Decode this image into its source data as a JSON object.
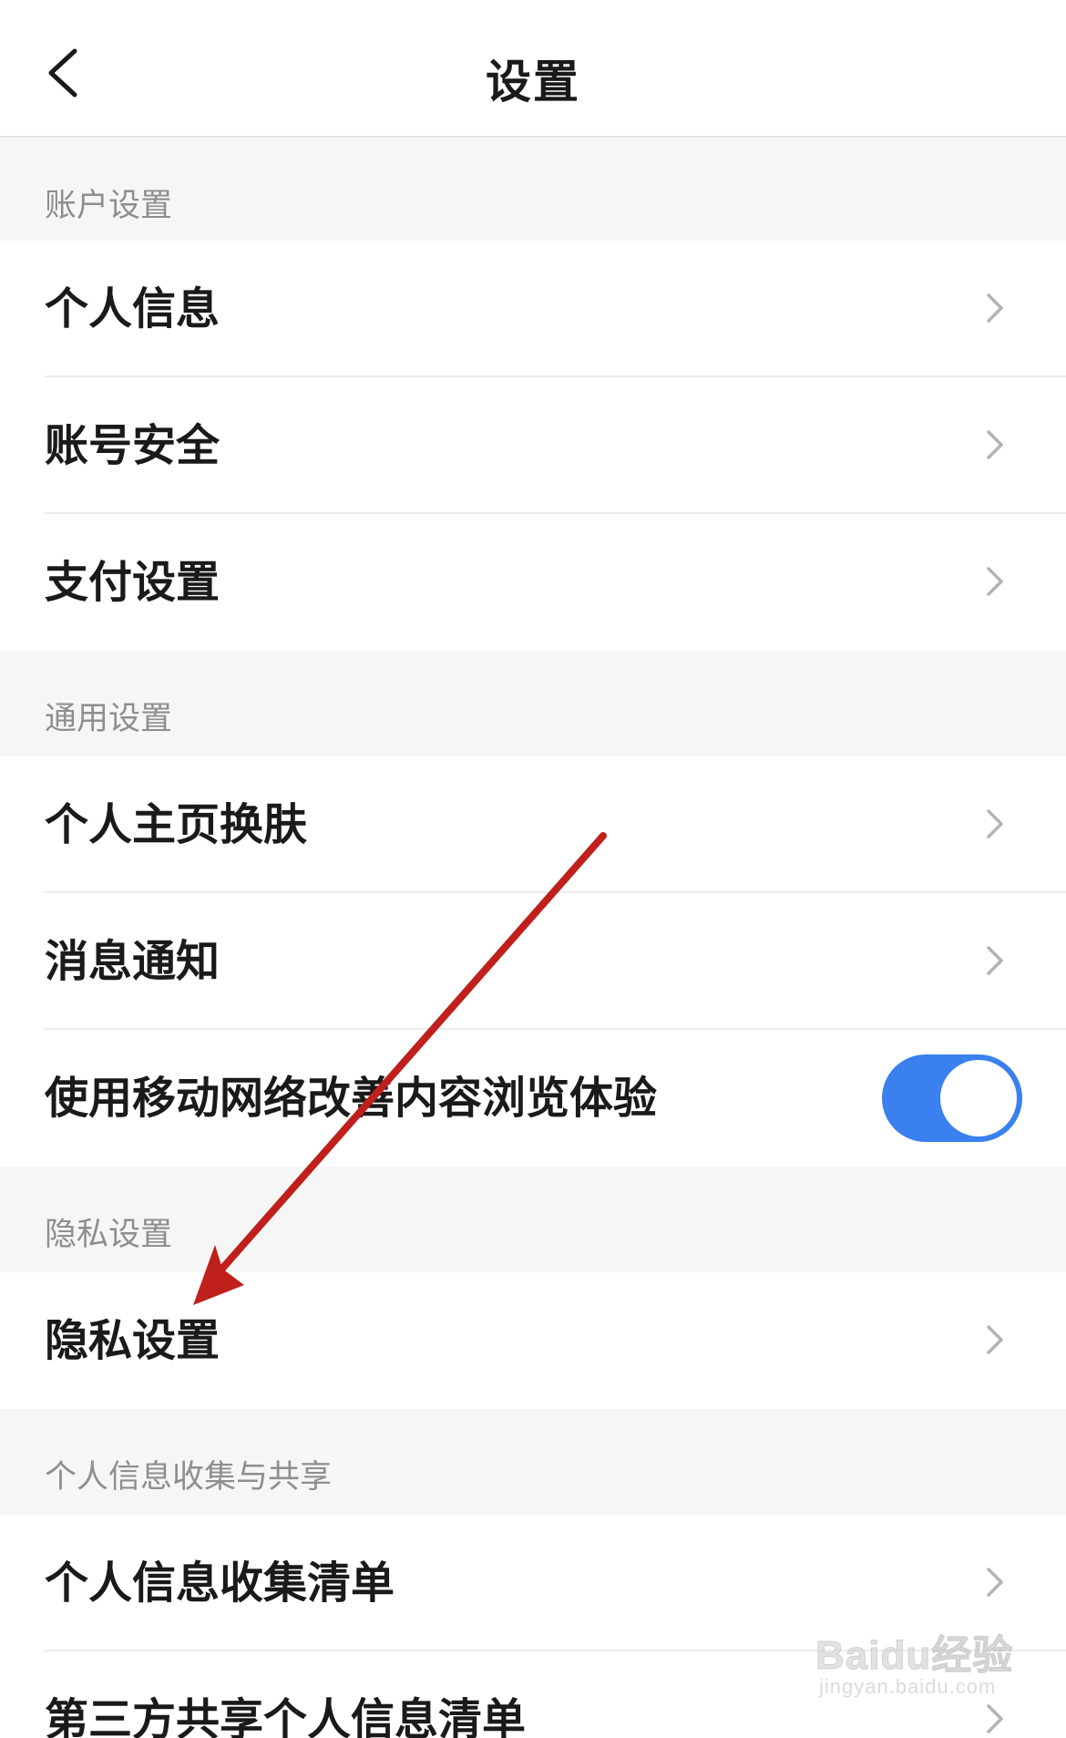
{
  "header": {
    "title": "设置",
    "back_icon": "chevron-left-icon"
  },
  "sections": {
    "account": {
      "title": "账户设置",
      "items": [
        "个人信息",
        "账号安全",
        "支付设置"
      ]
    },
    "general": {
      "title": "通用设置",
      "items": [
        "个人主页换肤",
        "消息通知",
        "使用移动网络改善内容浏览体验"
      ],
      "toggle_on": true
    },
    "privacy": {
      "title": "隐私设置",
      "items": [
        "隐私设置"
      ]
    },
    "personal_info": {
      "title": "个人信息收集与共享",
      "items": [
        "个人信息收集清单",
        "第三方共享个人信息清单"
      ]
    }
  },
  "colors": {
    "toggle_accent": "#3a80ee",
    "annotation_arrow": "#c0201c",
    "section_text": "#8e8e8e"
  },
  "watermark": {
    "logo": "Baidu经验",
    "domain": "jingyan.baidu.com"
  }
}
